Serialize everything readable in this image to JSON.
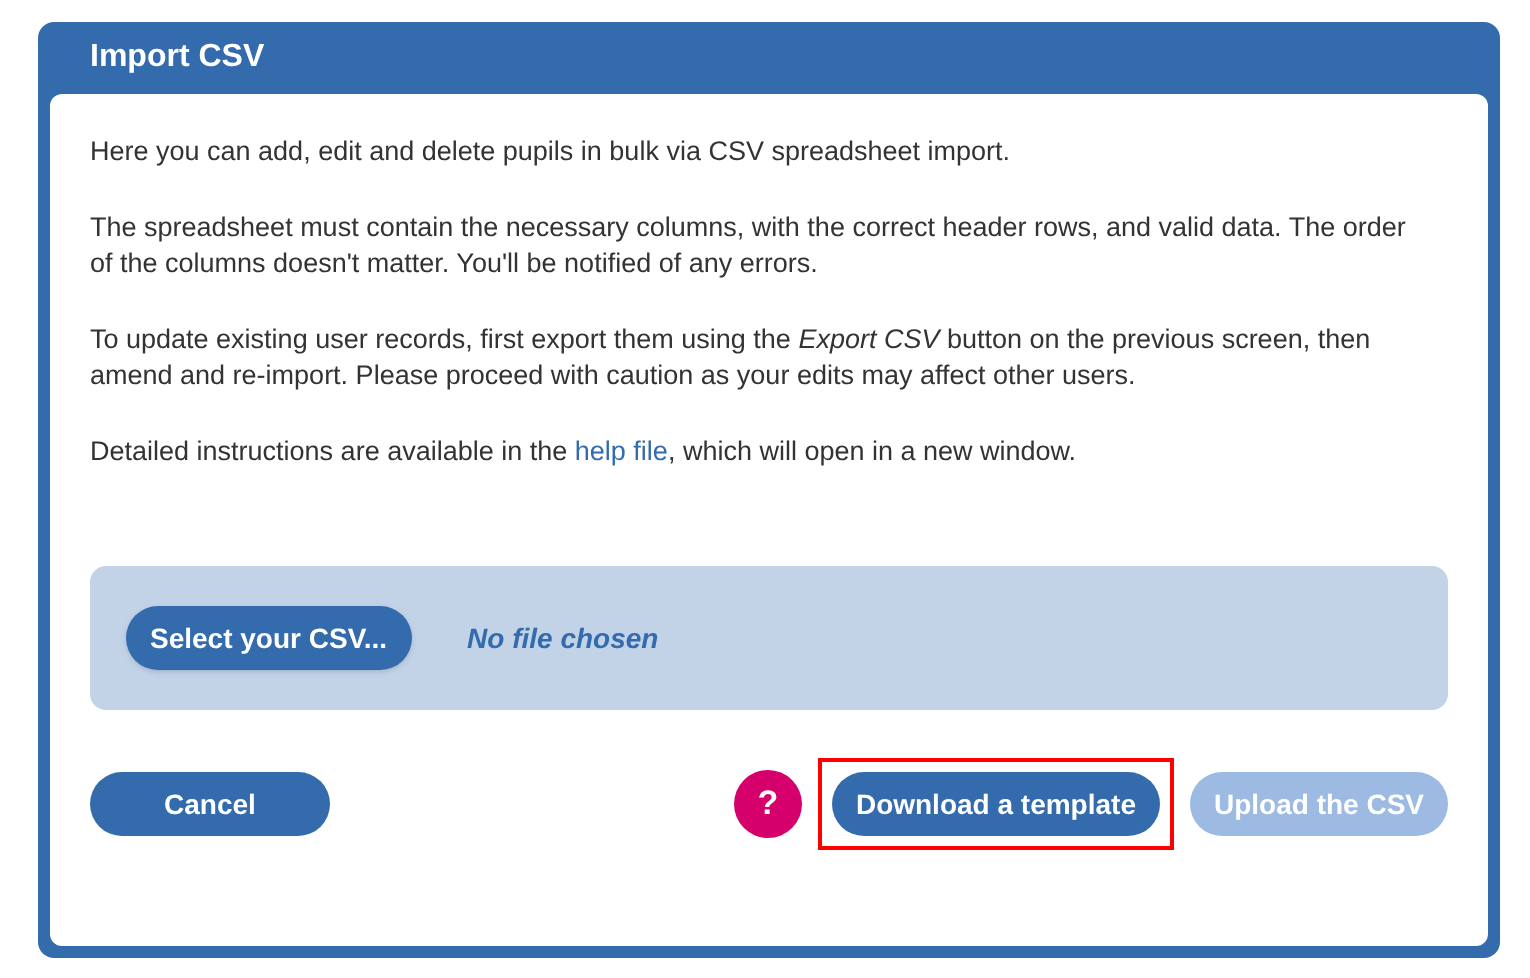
{
  "window": {
    "title": "Import CSV"
  },
  "paragraphs": [
    {
      "kind": "text",
      "text": "Here you can add, edit and delete pupils in bulk via CSV spreadsheet import."
    },
    {
      "kind": "text",
      "text": "The spreadsheet must contain the necessary columns, with the correct header rows, and valid data. The order of the columns doesn't matter. You'll be notified of any errors."
    },
    {
      "kind": "text",
      "text": "To update existing user records, first export them using the *Export CSV* button on the previous screen, then amend and re-import. Please proceed with caution as your edits may affect other users."
    },
    {
      "kind": "link",
      "before": "Detailed instructions are available in the ",
      "link": "help file",
      "after": ", which will open in a new window."
    }
  ],
  "file_picker": {
    "button": "Select your CSV...",
    "status": "No file chosen"
  },
  "footer": {
    "cancel": "Cancel",
    "help": "?",
    "buttons": [
      {
        "label": "Download a template",
        "disabled": false,
        "highlighted": true
      },
      {
        "label": "Upload the CSV",
        "disabled": true,
        "highlighted": false
      }
    ]
  }
}
